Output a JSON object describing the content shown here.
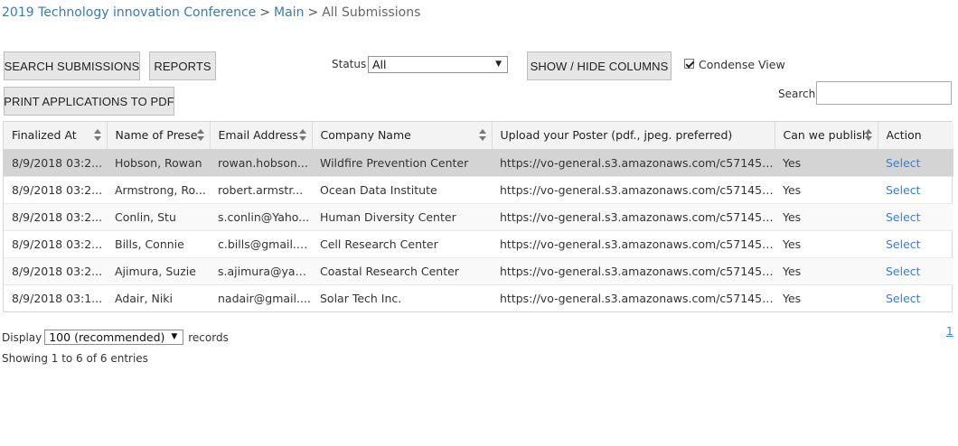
{
  "breadcrumb": {
    "conference": "2019 Technology innovation Conference",
    "sep1": ">",
    "main": "Main",
    "sep2": ">",
    "current": "All Submissions"
  },
  "toolbar": {
    "search_submissions": "SEARCH SUBMISSIONS",
    "reports": "REPORTS",
    "status_label": "Status",
    "status_value": "All",
    "show_hide_columns": "SHOW / HIDE COLUMNS",
    "condense_view": "Condense View",
    "condense_checked": true,
    "print_pdf": "PRINT APPLICATIONS TO PDF",
    "search_label": "Search:",
    "search_value": ""
  },
  "table": {
    "columns": [
      "Finalized At",
      "Name of Prese",
      "Email Address",
      "Company Name",
      "Upload your Poster (pdf., jpeg. preferred)",
      "Can we publish",
      "Action"
    ],
    "rows": [
      [
        "8/9/2018 03:2...",
        "Hobson, Rowan",
        "rowan.hobson...",
        "Wildfire Prevention Center",
        "https://vo-general.s3.amazonaws.com/c571454...",
        "Yes",
        "Select"
      ],
      [
        "8/9/2018 03:2...",
        "Armstrong, Ro...",
        "robert.armstr...",
        "Ocean Data Institute",
        "https://vo-general.s3.amazonaws.com/c571454...",
        "Yes",
        "Select"
      ],
      [
        "8/9/2018 03:2...",
        "Conlin, Stu",
        "s.conlin@Yaho...",
        "Human Diversity Center",
        "https://vo-general.s3.amazonaws.com/c571454...",
        "Yes",
        "Select"
      ],
      [
        "8/9/2018 03:2...",
        "Bills, Connie",
        "c.bills@gmail.c...",
        "Cell Research Center",
        "https://vo-general.s3.amazonaws.com/c571454...",
        "Yes",
        "Select"
      ],
      [
        "8/9/2018 03:2...",
        "Ajimura, Suzie",
        "s.ajimura@yah...",
        "Coastal Research Center",
        "https://vo-general.s3.amazonaws.com/c571454...",
        "Yes",
        "Select"
      ],
      [
        "8/9/2018 03:1...",
        "Adair, Niki",
        "nadair@gmail....",
        "Solar Tech Inc.",
        "https://vo-general.s3.amazonaws.com/c571454...",
        "Yes",
        "Select"
      ]
    ]
  },
  "footer": {
    "display_label": "Display",
    "display_value": "100 (recommended)",
    "records_label": "records",
    "showing_text": "Showing 1 to 6 of 6 entries",
    "page": "1"
  },
  "colors": {
    "link": "#3a80c9",
    "breadcrumb_link": "#3a7ca5",
    "button_bg": "#e6e6e6",
    "highlight_row": "#d4d4d4"
  }
}
